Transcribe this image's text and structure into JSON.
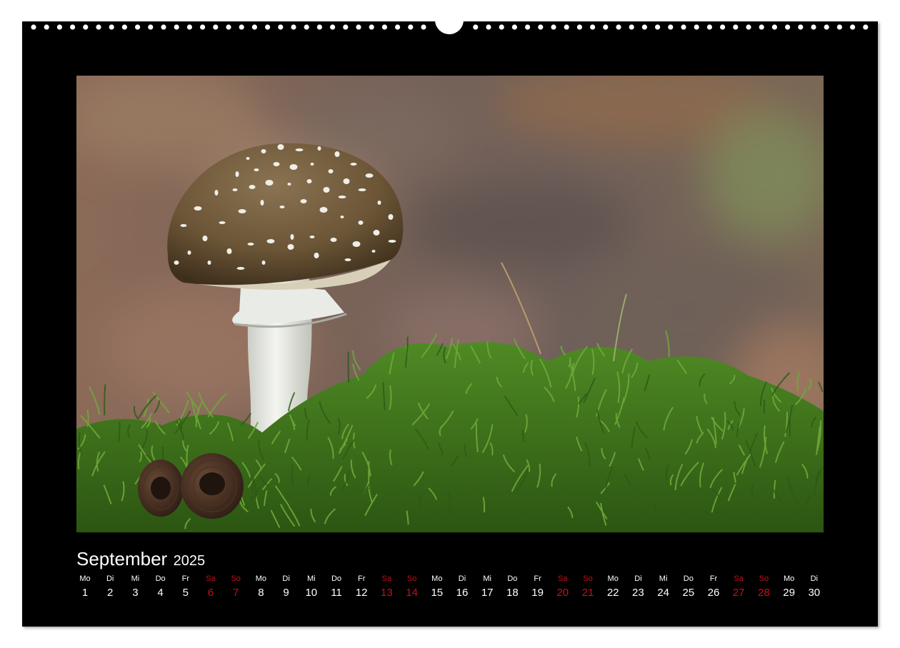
{
  "calendar": {
    "month": "September",
    "year": "2025",
    "days": [
      {
        "dn": "Mo",
        "num": "1",
        "we": false
      },
      {
        "dn": "Di",
        "num": "2",
        "we": false
      },
      {
        "dn": "Mi",
        "num": "3",
        "we": false
      },
      {
        "dn": "Do",
        "num": "4",
        "we": false
      },
      {
        "dn": "Fr",
        "num": "5",
        "we": false
      },
      {
        "dn": "Sa",
        "num": "6",
        "we": true
      },
      {
        "dn": "So",
        "num": "7",
        "we": true
      },
      {
        "dn": "Mo",
        "num": "8",
        "we": false
      },
      {
        "dn": "Di",
        "num": "9",
        "we": false
      },
      {
        "dn": "Mi",
        "num": "10",
        "we": false
      },
      {
        "dn": "Do",
        "num": "11",
        "we": false
      },
      {
        "dn": "Fr",
        "num": "12",
        "we": false
      },
      {
        "dn": "Sa",
        "num": "13",
        "we": true
      },
      {
        "dn": "So",
        "num": "14",
        "we": true
      },
      {
        "dn": "Mo",
        "num": "15",
        "we": false
      },
      {
        "dn": "Di",
        "num": "16",
        "we": false
      },
      {
        "dn": "Mi",
        "num": "17",
        "we": false
      },
      {
        "dn": "Do",
        "num": "18",
        "we": false
      },
      {
        "dn": "Fr",
        "num": "19",
        "we": false
      },
      {
        "dn": "Sa",
        "num": "20",
        "we": true
      },
      {
        "dn": "So",
        "num": "21",
        "we": true
      },
      {
        "dn": "Mo",
        "num": "22",
        "we": false
      },
      {
        "dn": "Di",
        "num": "23",
        "we": false
      },
      {
        "dn": "Mi",
        "num": "24",
        "we": false
      },
      {
        "dn": "Do",
        "num": "25",
        "we": false
      },
      {
        "dn": "Fr",
        "num": "26",
        "we": false
      },
      {
        "dn": "Sa",
        "num": "27",
        "we": true
      },
      {
        "dn": "So",
        "num": "28",
        "we": true
      },
      {
        "dn": "Mo",
        "num": "29",
        "we": false
      },
      {
        "dn": "Di",
        "num": "30",
        "we": false
      }
    ]
  },
  "colors": {
    "background": "#000000",
    "text": "#ffffff",
    "weekend": "#c8101c",
    "moss": "#4e8a22",
    "cap": "#6b5536",
    "stem": "#eceee8"
  },
  "photo": {
    "subject": "mushroom-on-moss"
  }
}
